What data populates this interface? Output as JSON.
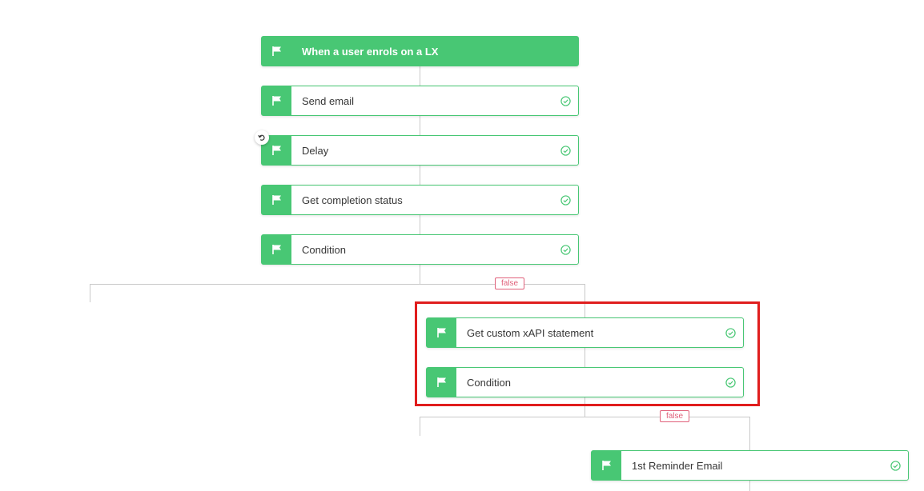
{
  "workflow": {
    "nodes": [
      {
        "id": "trigger",
        "label": "When a user enrols on a LX",
        "kind": "trigger",
        "icon": "flag-icon",
        "status": ""
      },
      {
        "id": "send-email",
        "label": "Send email",
        "kind": "action",
        "icon": "flag-icon",
        "status": "complete"
      },
      {
        "id": "delay",
        "label": "Delay",
        "kind": "action",
        "icon": "flag-icon",
        "status": "complete"
      },
      {
        "id": "get-completion-status",
        "label": "Get completion status",
        "kind": "action",
        "icon": "flag-icon",
        "status": "complete"
      },
      {
        "id": "condition-1",
        "label": "Condition",
        "kind": "condition",
        "icon": "flag-icon",
        "status": "complete"
      },
      {
        "id": "get-custom-xapi",
        "label": "Get custom xAPI statement",
        "kind": "action",
        "icon": "flag-icon",
        "status": "complete"
      },
      {
        "id": "condition-2",
        "label": "Condition",
        "kind": "condition",
        "icon": "flag-icon",
        "status": "complete"
      },
      {
        "id": "first-reminder-email",
        "label": "1st Reminder Email",
        "kind": "action",
        "icon": "flag-icon",
        "status": "complete"
      }
    ],
    "branch_labels": {
      "condition_1_false": "false",
      "condition_2_false": "false"
    },
    "undo_icon": "undo-icon",
    "status_icon": "check-circle-icon"
  },
  "colors": {
    "node_green": "#48c774",
    "connector_gray": "#c9c9c9",
    "false_badge": "#e0607a",
    "highlight_red": "#e01d1d",
    "label_text": "#363636"
  }
}
